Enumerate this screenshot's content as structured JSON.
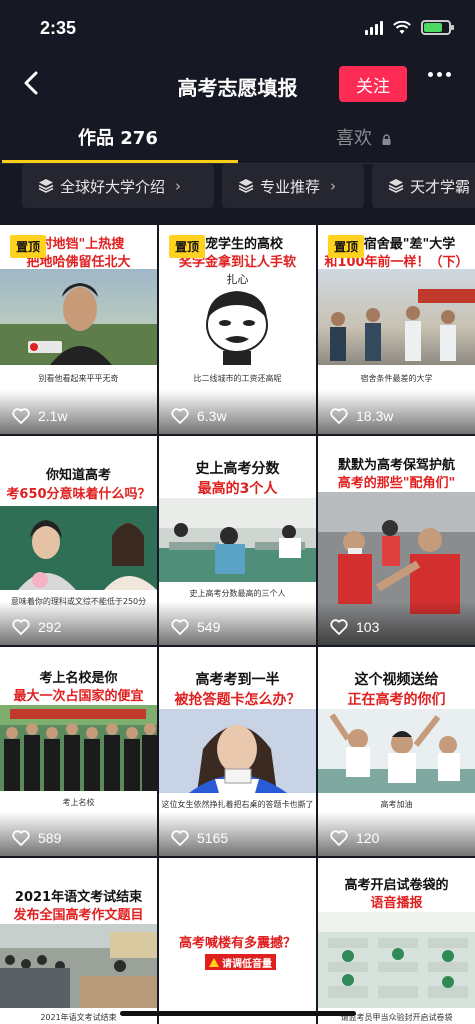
{
  "status_bar": {
    "time": "2:35"
  },
  "header": {
    "title": "高考志愿填报",
    "follow_label": "关注"
  },
  "tabs": {
    "works_label": "作品 276",
    "likes_label": "喜欢"
  },
  "chips": [
    {
      "label": "全球好大学介绍"
    },
    {
      "label": "专业推荐"
    },
    {
      "label": "天才学霸"
    }
  ],
  "colors": {
    "accent": "#fe2c55",
    "underline": "#face15",
    "background": "#161823",
    "pin": "#ffd21f"
  },
  "videos": [
    {
      "pinned": "置顶",
      "title1": "\"村地铛\"上热搜",
      "title2": "把地哈佛留任北大",
      "caption": "别看他看起来平平无奇",
      "likes": "2.1w"
    },
    {
      "pinned": "置顶",
      "title1": "最宠学生的高校",
      "title2": "奖学金拿到让人手软",
      "caption": "比二线城市的工资还高呢",
      "likes": "6.3w",
      "overlay": "扎心"
    },
    {
      "pinned": "置顶",
      "title1": "国内宿舍最\"差\"大学",
      "title2": "和100年前一样！（下）",
      "caption": "宿舍条件最差的大学",
      "likes": "18.3w"
    },
    {
      "title1": "你知道高考",
      "title2": "考650分意味着什么吗？",
      "caption": "意味着你的理科或文综不能低于250分",
      "likes": "292"
    },
    {
      "title1": "史上高考分数",
      "title2": "最高的3个人",
      "caption": "史上高考分数最高的三个人",
      "likes": "549"
    },
    {
      "title1": "默默为高考保驾护航",
      "title2": "高考的那些\"配角们\"",
      "caption": "",
      "likes": "103"
    },
    {
      "title1": "考上名校是你",
      "title2": "最大一次占国家的便宜",
      "caption": "考上名校",
      "likes": "589"
    },
    {
      "title1": "高考考到一半",
      "title2": "被抢答题卡怎么办？",
      "caption": "这位女生依然挣扎着把右桌的答题卡也撕了",
      "likes": "5165"
    },
    {
      "title1": "这个视频送给",
      "title2": "正在高考的你们",
      "caption": "高考加油",
      "likes": "120"
    },
    {
      "title1": "2021年语文考试结束",
      "title2": "发布全国高考作文题目",
      "caption": "2021年语文考试结束",
      "likes": ""
    },
    {
      "title1": "",
      "title2": "高考喊楼有多震撼？",
      "caption": "",
      "likes": "",
      "badge": "请调低音量"
    },
    {
      "title1": "高考开启试卷袋的",
      "title2": "语音播报",
      "caption": "请监考员甲当众验封开启试卷袋",
      "likes": ""
    }
  ]
}
